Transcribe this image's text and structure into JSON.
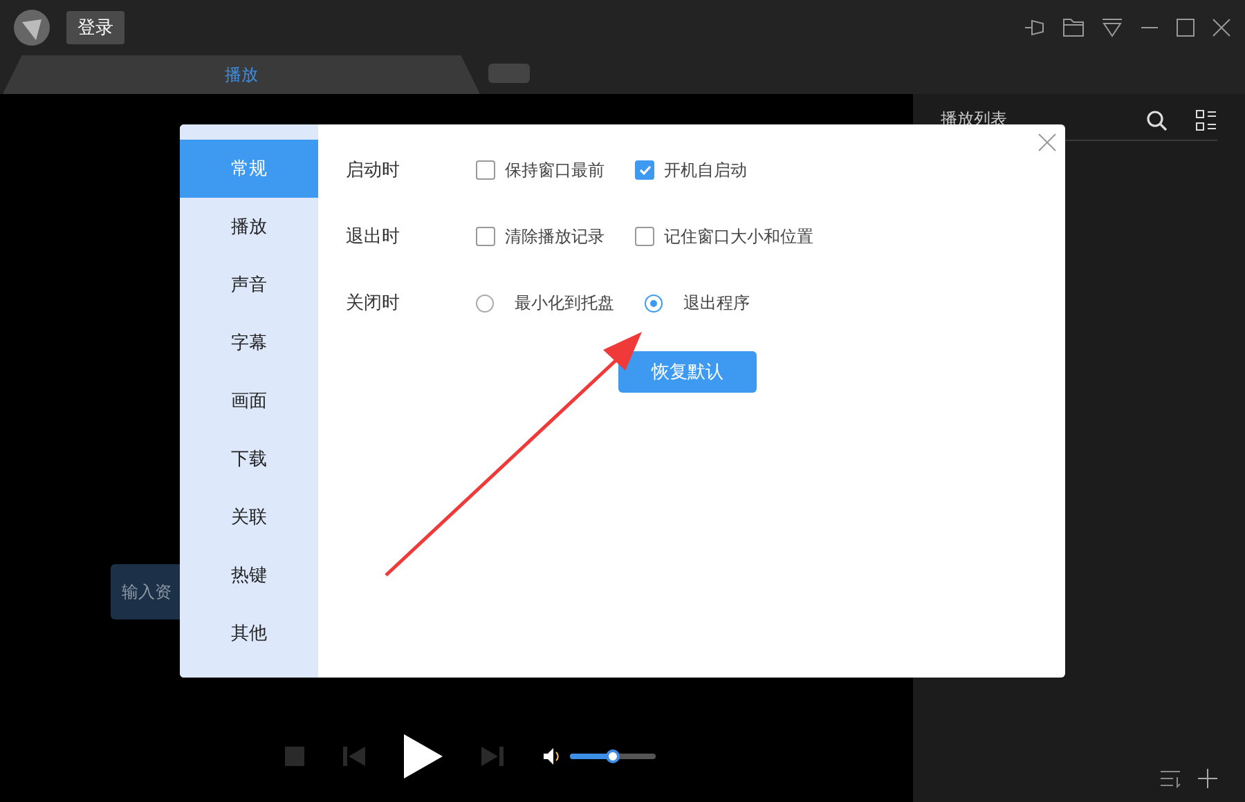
{
  "titlebar": {
    "login_button": "登录"
  },
  "tab": {
    "label": "播放",
    "selected": true
  },
  "url_input": {
    "placeholder": "输入资"
  },
  "playlist": {
    "title": "播放列表"
  },
  "player": {
    "volume": {
      "level": 0.5
    }
  },
  "settings_dialog": {
    "nav": [
      {
        "label": "常规",
        "selected": true
      },
      {
        "label": "播放",
        "selected": false
      },
      {
        "label": "声音",
        "selected": false
      },
      {
        "label": "字幕",
        "selected": false
      },
      {
        "label": "画面",
        "selected": false
      },
      {
        "label": "下载",
        "selected": false
      },
      {
        "label": "关联",
        "selected": false
      },
      {
        "label": "热键",
        "selected": false
      },
      {
        "label": "其他",
        "selected": false
      }
    ],
    "rows": [
      {
        "label": "启动时",
        "options": [
          {
            "kind": "checkbox",
            "label": "保持窗口最前",
            "checked": false
          },
          {
            "kind": "checkbox",
            "label": "开机自启动",
            "checked": true
          }
        ]
      },
      {
        "label": "退出时",
        "options": [
          {
            "kind": "checkbox",
            "label": "清除播放记录",
            "checked": false
          },
          {
            "kind": "checkbox",
            "label": "记住窗口大小和位置",
            "checked": false
          }
        ]
      },
      {
        "label": "关闭时",
        "options": [
          {
            "kind": "radio",
            "label": "最小化到托盘",
            "selected": false
          },
          {
            "kind": "radio",
            "label": "退出程序",
            "selected": true
          }
        ]
      }
    ],
    "reset_button": "恢复默认"
  }
}
